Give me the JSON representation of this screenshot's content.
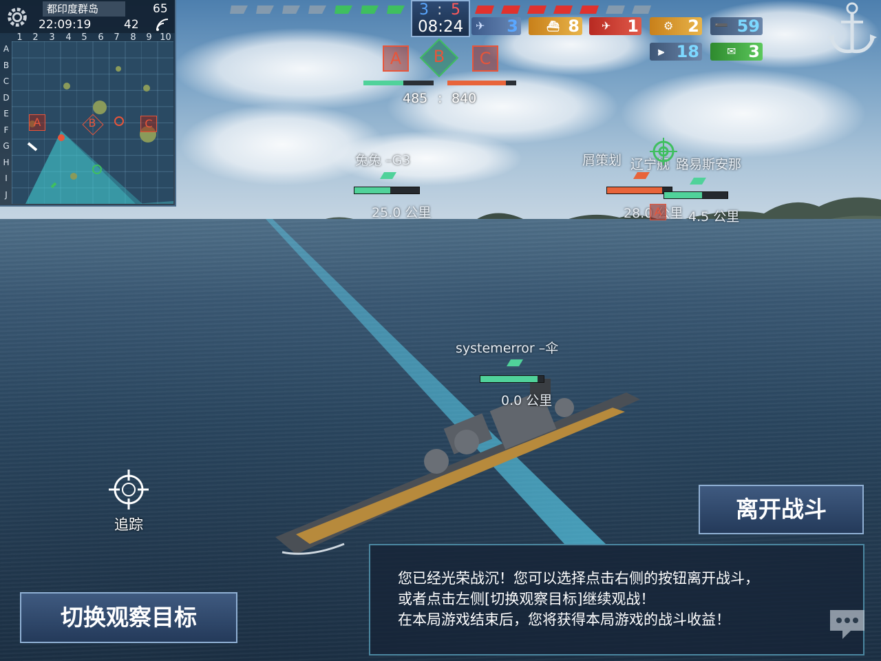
{
  "minimap": {
    "map_name": "都印度群岛",
    "clock": "22:09:19",
    "fps": "65",
    "ping": "42",
    "columns": [
      "1",
      "2",
      "3",
      "4",
      "5",
      "6",
      "7",
      "8",
      "9",
      "10"
    ],
    "rows": [
      "A",
      "B",
      "C",
      "D",
      "E",
      "F",
      "G",
      "H",
      "I",
      "J"
    ],
    "points": [
      {
        "label": "A",
        "color": "#e8553a"
      },
      {
        "label": "B",
        "color": "#e8553a"
      },
      {
        "label": "C",
        "color": "#e8553a"
      }
    ]
  },
  "score": {
    "blue": "3",
    "colon": ":",
    "red": "5",
    "timer": "08:24"
  },
  "stats": [
    {
      "value": "3",
      "color": "#5aa7ff",
      "icon": "plane-icon",
      "bg": "#3c5a8a"
    },
    {
      "value": "8",
      "color": "#ffffff",
      "icon": "destroyer-icon",
      "bg": "#d89a2a"
    },
    {
      "value": "1",
      "color": "#ffffff",
      "icon": "carrier-icon",
      "bg": "#c8382e"
    },
    {
      "value": "2",
      "color": "#ffffff",
      "icon": "gear-icon",
      "bg": "#d89a2a"
    },
    {
      "value": "59",
      "color": "#7dd8ff",
      "icon": "torpedo-icon",
      "bg": "#4a6388"
    },
    {
      "value": "18",
      "color": "#7dd8ff",
      "icon": "shell-icon",
      "bg": "#4a6388"
    },
    {
      "value": "3",
      "color": "#ffffff",
      "icon": "mail-icon",
      "bg": "#3a9a3a"
    }
  ],
  "objectives": [
    {
      "label": "A",
      "color": "#e8553a"
    },
    {
      "label": "B",
      "color": "#3fbf5f"
    },
    {
      "label": "C",
      "color": "#e8553a"
    }
  ],
  "team_points": {
    "blue": "485",
    "colon": ":",
    "red": "840",
    "blue_fraction": 0.57,
    "red_fraction": 0.85
  },
  "ships": [
    {
      "name": "兔兔 –G3",
      "distance": "25.0 公里",
      "hp": 0.55,
      "color": "#50d29a"
    },
    {
      "name": "屑策划",
      "distance": "28.0 公里",
      "hp": 0.85,
      "color": "#e8643a"
    },
    {
      "name": "辽宁舰",
      "distance": "",
      "hp": 0,
      "color": "#e8643a"
    },
    {
      "name": "路易斯安那",
      "distance": "4.5 公里",
      "hp": 0.6,
      "color": "#50d29a"
    },
    {
      "name": "systemerror –伞",
      "distance": "0.0  公里",
      "hp": 0.9,
      "color": "#50d29a"
    }
  ],
  "track_label": "追踪",
  "leave_button": "离开战斗",
  "switch_button": "切换观察目标",
  "message": {
    "line1": "您已经光荣战沉！您可以选择点击右侧的按钮离开战斗，",
    "line2": "或者点击左侧[切换观察目标]继续观战！",
    "line3": "在本局游戏结束后，您将获得本局游戏的战斗收益！"
  }
}
